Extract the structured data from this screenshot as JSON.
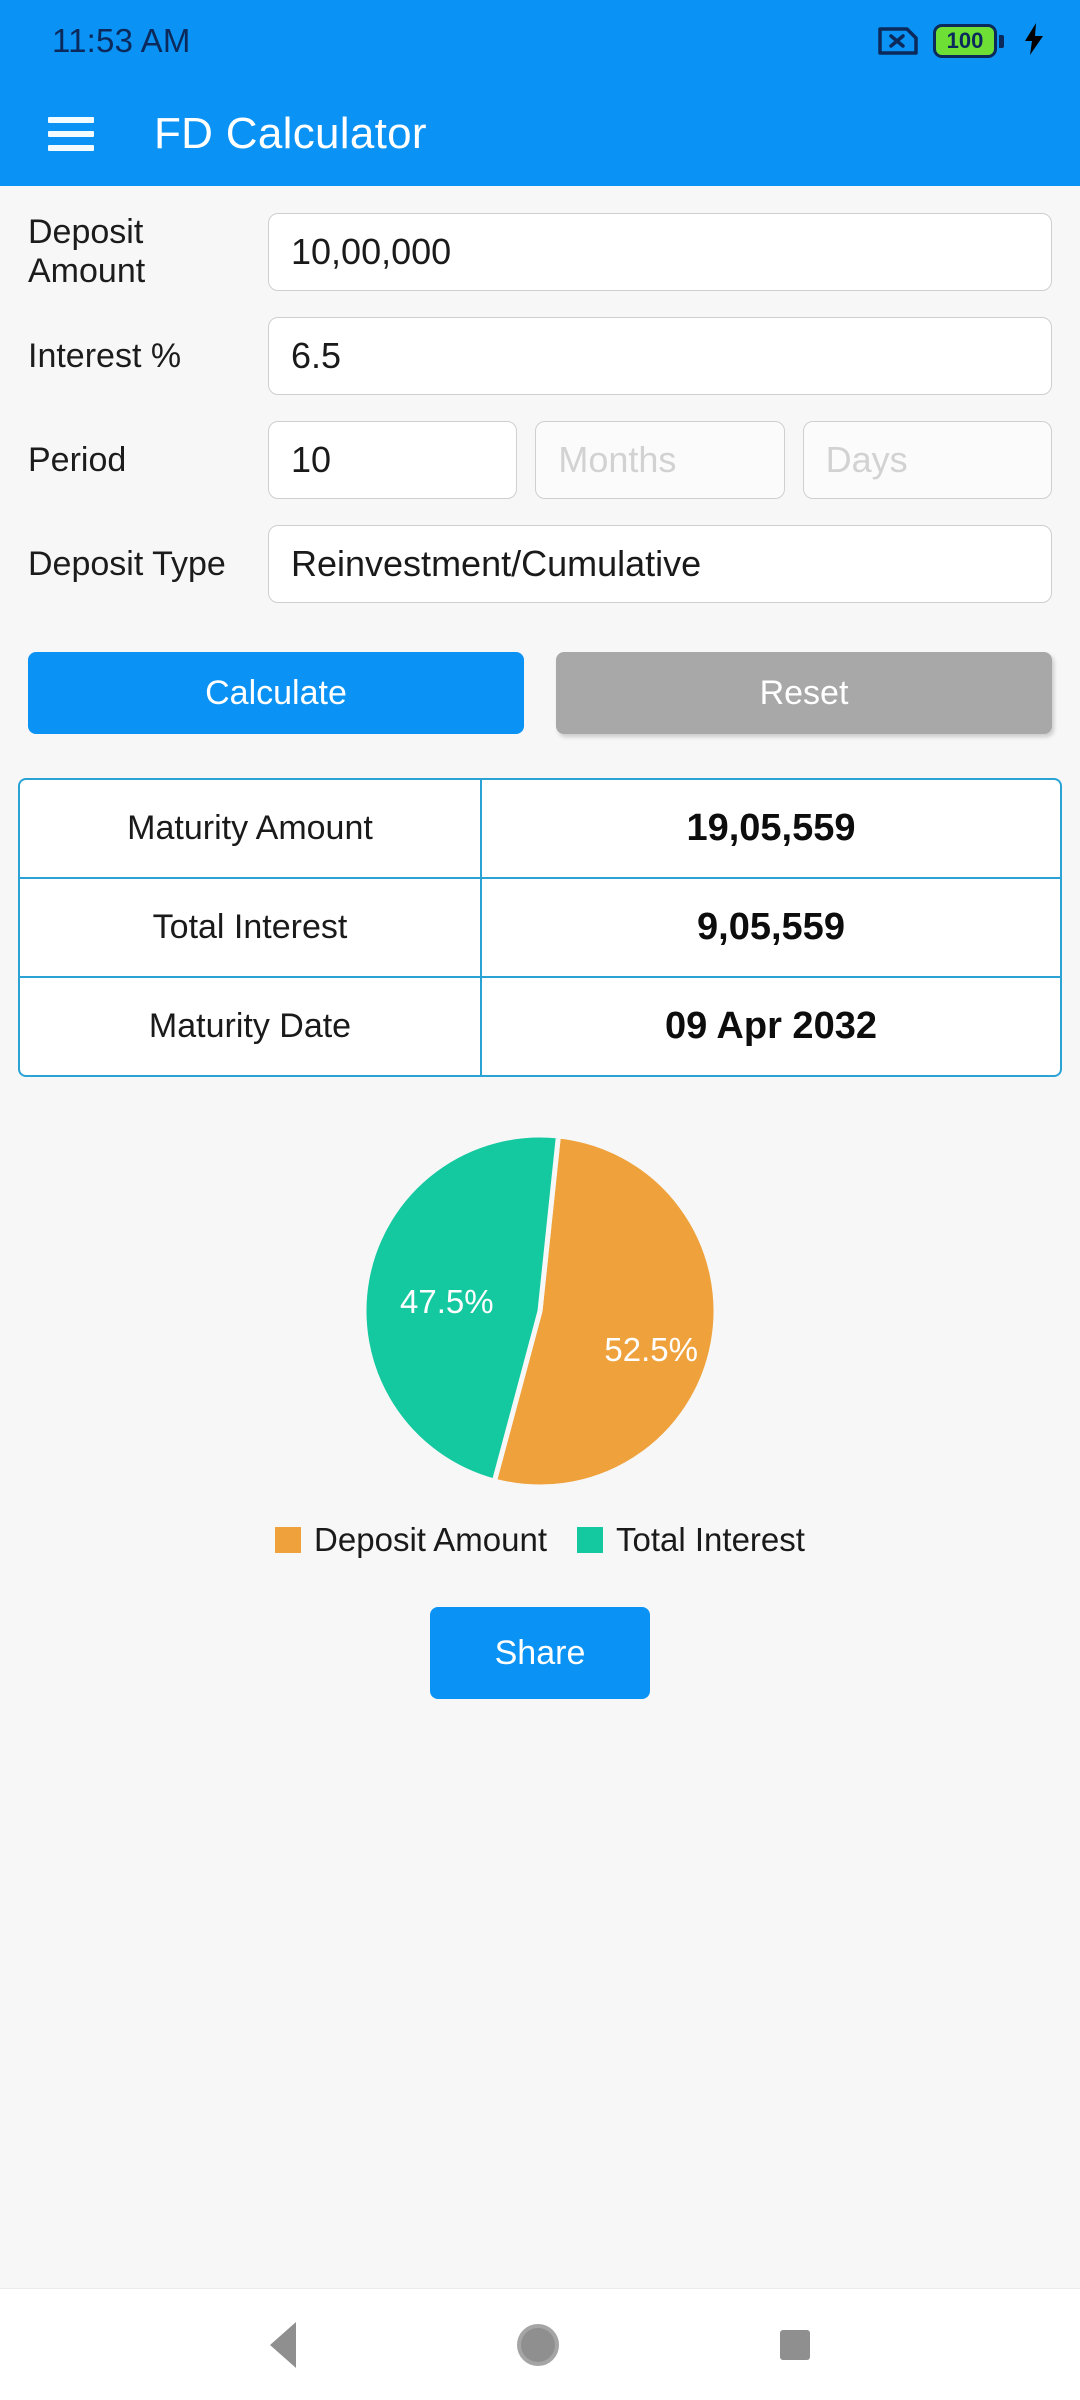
{
  "status_bar": {
    "time": "11:53 AM",
    "sim_icon": "sim-card-disabled-icon",
    "battery_level": "100",
    "charging_icon": "lightning-bolt-icon"
  },
  "app_bar": {
    "menu_icon": "hamburger-menu-icon",
    "title": "FD Calculator"
  },
  "form": {
    "deposit_amount": {
      "label": "Deposit Amount",
      "value": "10,00,000"
    },
    "interest": {
      "label": "Interest %",
      "value": "6.5"
    },
    "period": {
      "label": "Period",
      "years_value": "10",
      "months_placeholder": "Months",
      "days_placeholder": "Days"
    },
    "deposit_type": {
      "label": "Deposit Type",
      "value": "Reinvestment/Cumulative"
    }
  },
  "actions": {
    "calculate_label": "Calculate",
    "reset_label": "Reset",
    "share_label": "Share"
  },
  "results": {
    "rows": [
      {
        "label": "Maturity Amount",
        "value": "19,05,559"
      },
      {
        "label": "Total Interest",
        "value": "9,05,559"
      },
      {
        "label": "Maturity Date",
        "value": "09 Apr 2032"
      }
    ]
  },
  "chart_data": {
    "type": "pie",
    "title": "",
    "categories": [
      "Deposit Amount",
      "Total Interest"
    ],
    "values": [
      52.5,
      47.5
    ],
    "labels": [
      "52.5%",
      "47.5%"
    ],
    "colors": [
      "#efa23c",
      "#14c8a0"
    ],
    "legend_position": "bottom",
    "legend": [
      {
        "name": "Deposit Amount",
        "color": "#efa23c"
      },
      {
        "name": "Total Interest",
        "color": "#14c8a0"
      }
    ]
  },
  "nav_bar": {
    "back_icon": "back-triangle-icon",
    "home_icon": "home-circle-icon",
    "recents_icon": "recents-square-icon"
  },
  "colors": {
    "accent": "#0a93f5",
    "table_border": "#2aa3d4",
    "orange": "#efa23c",
    "teal": "#14c8a0",
    "reset_gray": "#a8a8a8"
  }
}
